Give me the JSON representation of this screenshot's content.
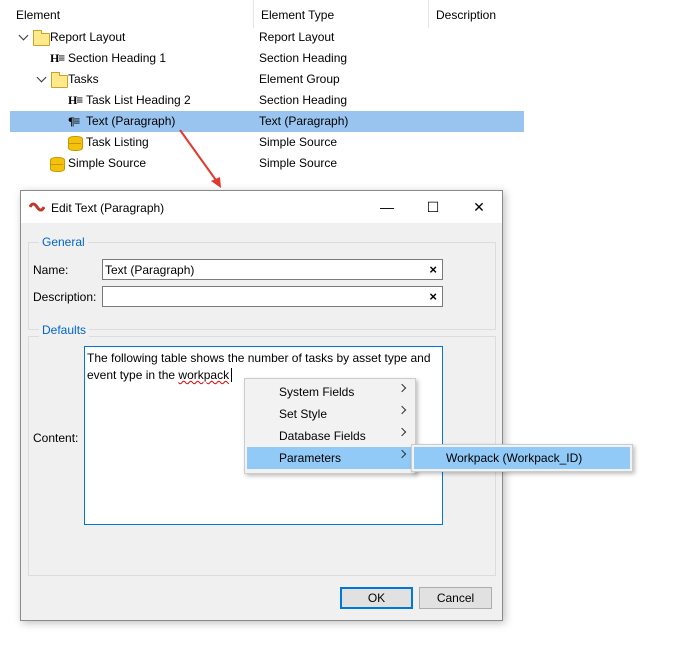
{
  "tree": {
    "columns": [
      "Element",
      "Element Type",
      "Description"
    ],
    "rows": [
      {
        "label": "Report Layout",
        "type": "Report Layout",
        "icon": "folder-icon"
      },
      {
        "label": "Section Heading 1",
        "type": "Section Heading",
        "icon": "heading-icon"
      },
      {
        "label": "Tasks",
        "type": "Element Group",
        "icon": "folder-icon"
      },
      {
        "label": "Task List Heading 2",
        "type": "Section Heading",
        "icon": "heading-icon"
      },
      {
        "label": "Text (Paragraph)",
        "type": "Text (Paragraph)",
        "icon": "paragraph-icon",
        "selected": true
      },
      {
        "label": "Task Listing",
        "type": "Simple Source",
        "icon": "database-icon"
      },
      {
        "label": "Simple Source",
        "type": "Simple Source",
        "icon": "database-icon"
      }
    ],
    "heading_glyph": "H≡",
    "paragraph_glyph": "¶≡"
  },
  "dialog": {
    "title": "Edit Text (Paragraph)",
    "minimize": "—",
    "maximize": "☐",
    "close": "✕",
    "general_label": "General",
    "name_label": "Name:",
    "name_value": "Text (Paragraph)",
    "description_label": "Description:",
    "description_value": "",
    "clear_glyph": "×",
    "defaults_label": "Defaults",
    "content_label": "Content:",
    "content_value_1": "The following table shows the number of tasks by asset type and event type in the ",
    "content_value_2": "workpack",
    "ok_label": "OK",
    "cancel_label": "Cancel"
  },
  "context_menu": {
    "items": [
      "System Fields",
      "Set Style",
      "Database Fields",
      "Parameters"
    ],
    "highlighted": "Parameters"
  },
  "submenu": {
    "items": [
      "Workpack (Workpack_ID)"
    ]
  },
  "colors": {
    "selection": "#99c4f0",
    "menu_highlight": "#91c9f7",
    "accent": "#0078d7",
    "arrow": "#e03a2f"
  }
}
